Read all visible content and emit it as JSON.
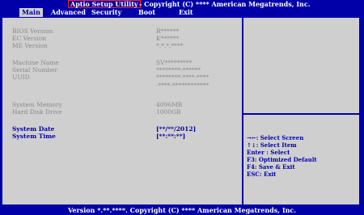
{
  "title": {
    "app_name": "Aptio Setup Utility",
    "copyright": "- Copyright (C) **** American Megatrends, Inc."
  },
  "tabs": [
    "Main",
    "Advanced",
    "Security",
    "Boot",
    "Exit"
  ],
  "info": {
    "bios_version": {
      "label": "BIOS Version",
      "value": "R******"
    },
    "ec_version": {
      "label": "EC Version",
      "value": "K******"
    },
    "me_version": {
      "label": "ME Version",
      "value": "*.*.*.****"
    },
    "machine_name": {
      "label": "Machine Name",
      "value": "SV*********"
    },
    "serial_number": {
      "label": "Serial Number",
      "value": "********-******"
    },
    "uuid": {
      "label": "UUID",
      "value": "********-****-****",
      "value2": "-****-************"
    },
    "system_memory": {
      "label": "System Memory",
      "value": "4096MB"
    },
    "hard_disk": {
      "label": "Hard Disk Drive",
      "value": "1000GB"
    }
  },
  "settings": {
    "system_date": {
      "label": "System Date",
      "value": "[**/**/2012]"
    },
    "system_time": {
      "label": "System Time",
      "value": "[**:**:**]"
    }
  },
  "help": [
    "→←: Select Screen",
    "↑↓: Select Item",
    "Enter : Select",
    "F3: Optimized Default",
    "F4: Save & Exit",
    "ESC: Exit"
  ],
  "footer": "Version *.**.****. Copyright (C) **** American Megatrends, Inc.",
  "colors": {
    "background": "#0000a8",
    "panel": "#cfcfcf",
    "highlight": "#ff2020"
  }
}
